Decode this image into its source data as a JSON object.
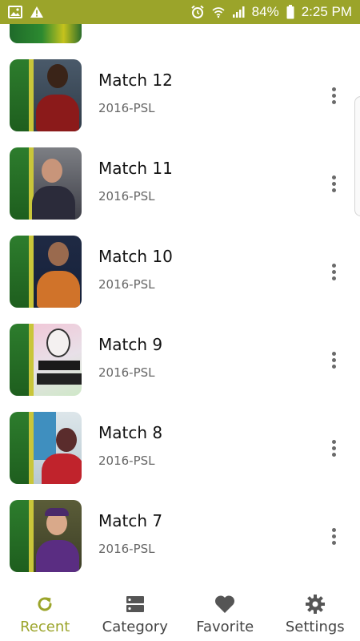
{
  "status_bar": {
    "battery_percent": "84%",
    "time": "2:25 PM",
    "bg_color": "#9ba42a",
    "icons": [
      "image-icon",
      "warning-icon",
      "alarm-icon",
      "wifi-icon",
      "signal-icon",
      "battery-icon"
    ]
  },
  "matches": [
    {
      "title": "Match 12",
      "subtitle": "2016-PSL"
    },
    {
      "title": "Match 11",
      "subtitle": "2016-PSL"
    },
    {
      "title": "Match 10",
      "subtitle": "2016-PSL"
    },
    {
      "title": "Match 9",
      "subtitle": "2016-PSL"
    },
    {
      "title": "Match 8",
      "subtitle": "2016-PSL"
    },
    {
      "title": "Match 7",
      "subtitle": "2016-PSL"
    }
  ],
  "bottom_nav": {
    "active_color": "#9ba42a",
    "items": [
      {
        "label": "Recent",
        "icon": "refresh-icon",
        "active": true
      },
      {
        "label": "Category",
        "icon": "category-icon",
        "active": false
      },
      {
        "label": "Favorite",
        "icon": "heart-icon",
        "active": false
      },
      {
        "label": "Settings",
        "icon": "gear-icon",
        "active": false
      }
    ]
  }
}
